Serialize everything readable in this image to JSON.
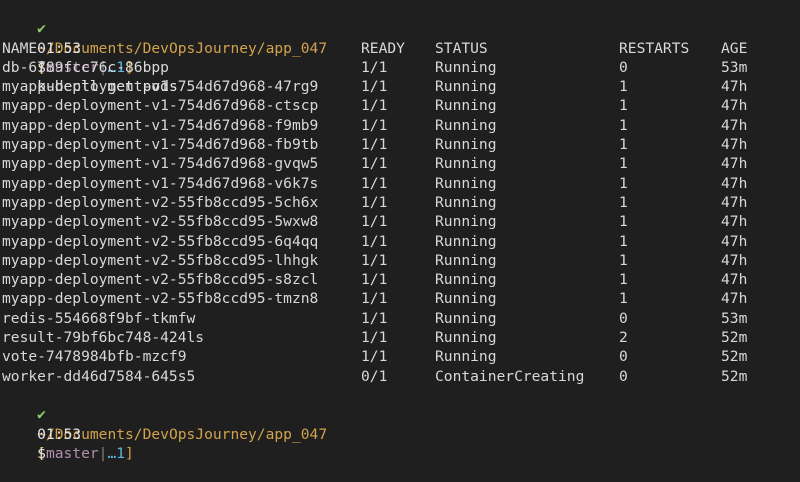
{
  "prompt1": {
    "check": "✔",
    "path": "~/Documents/DevOpsJourney/app_047",
    "bracket_open": "[",
    "branch": "master",
    "separator": "|",
    "ahead": "…1",
    "bracket_close": "]"
  },
  "command_line": {
    "time": "01:53",
    "dollar": "$",
    "command": "kubectl get pods"
  },
  "table": {
    "headers": {
      "name": "NAME",
      "ready": "READY",
      "status": "STATUS",
      "restarts": "RESTARTS",
      "age": "AGE"
    },
    "rows": [
      {
        "name": "db-6789fcc76c-86bpp",
        "ready": "1/1",
        "status": "Running",
        "restarts": "0",
        "age": "53m"
      },
      {
        "name": "myapp-deployment-v1-754d67d968-47rg9",
        "ready": "1/1",
        "status": "Running",
        "restarts": "1",
        "age": "47h"
      },
      {
        "name": "myapp-deployment-v1-754d67d968-ctscp",
        "ready": "1/1",
        "status": "Running",
        "restarts": "1",
        "age": "47h"
      },
      {
        "name": "myapp-deployment-v1-754d67d968-f9mb9",
        "ready": "1/1",
        "status": "Running",
        "restarts": "1",
        "age": "47h"
      },
      {
        "name": "myapp-deployment-v1-754d67d968-fb9tb",
        "ready": "1/1",
        "status": "Running",
        "restarts": "1",
        "age": "47h"
      },
      {
        "name": "myapp-deployment-v1-754d67d968-gvqw5",
        "ready": "1/1",
        "status": "Running",
        "restarts": "1",
        "age": "47h"
      },
      {
        "name": "myapp-deployment-v1-754d67d968-v6k7s",
        "ready": "1/1",
        "status": "Running",
        "restarts": "1",
        "age": "47h"
      },
      {
        "name": "myapp-deployment-v2-55fb8ccd95-5ch6x",
        "ready": "1/1",
        "status": "Running",
        "restarts": "1",
        "age": "47h"
      },
      {
        "name": "myapp-deployment-v2-55fb8ccd95-5wxw8",
        "ready": "1/1",
        "status": "Running",
        "restarts": "1",
        "age": "47h"
      },
      {
        "name": "myapp-deployment-v2-55fb8ccd95-6q4qq",
        "ready": "1/1",
        "status": "Running",
        "restarts": "1",
        "age": "47h"
      },
      {
        "name": "myapp-deployment-v2-55fb8ccd95-lhhgk",
        "ready": "1/1",
        "status": "Running",
        "restarts": "1",
        "age": "47h"
      },
      {
        "name": "myapp-deployment-v2-55fb8ccd95-s8zcl",
        "ready": "1/1",
        "status": "Running",
        "restarts": "1",
        "age": "47h"
      },
      {
        "name": "myapp-deployment-v2-55fb8ccd95-tmzn8",
        "ready": "1/1",
        "status": "Running",
        "restarts": "1",
        "age": "47h"
      },
      {
        "name": "redis-554668f9bf-tkmfw",
        "ready": "1/1",
        "status": "Running",
        "restarts": "0",
        "age": "53m"
      },
      {
        "name": "result-79bf6bc748-424ls",
        "ready": "1/1",
        "status": "Running",
        "restarts": "2",
        "age": "52m"
      },
      {
        "name": "vote-7478984bfb-mzcf9",
        "ready": "1/1",
        "status": "Running",
        "restarts": "0",
        "age": "52m"
      },
      {
        "name": "worker-dd46d7584-645s5",
        "ready": "0/1",
        "status": "ContainerCreating",
        "restarts": "0",
        "age": "52m"
      }
    ]
  },
  "prompt2": {
    "check": "✔",
    "path": "~/Documents/DevOpsJourney/app_047",
    "bracket_open": "[",
    "branch": "master",
    "separator": "|",
    "ahead": "…1",
    "bracket_close": "]"
  },
  "final_prompt": {
    "time": "01:53",
    "dollar": "$"
  },
  "colors": {
    "background": "#1f1f1f",
    "check": "#8fd16a",
    "path": "#d2a24c",
    "branch": "#b48ead",
    "ahead": "#5fb8e0"
  }
}
